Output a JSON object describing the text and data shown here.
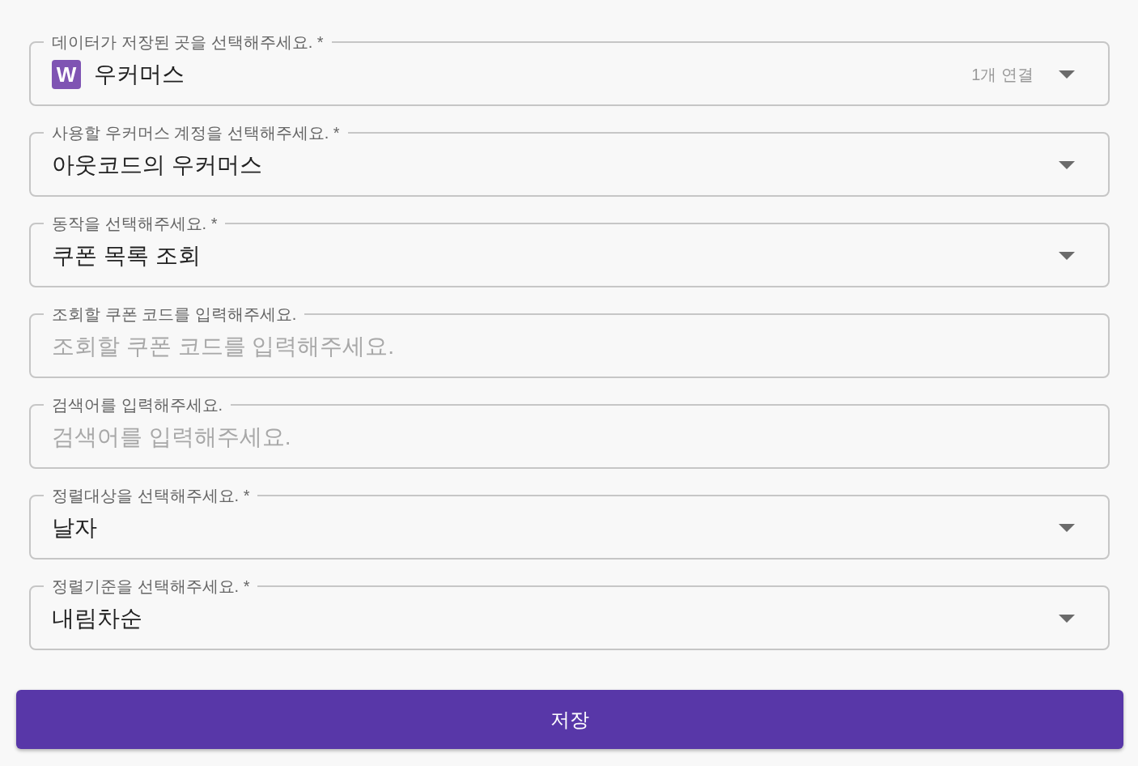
{
  "form": {
    "fields": [
      {
        "kind": "select",
        "label": "데이터가 저장된 곳을 선택해주세요. *",
        "logo": "W",
        "value": "우커머스",
        "hint": "1개 연결"
      },
      {
        "kind": "select",
        "label": "사용할 우커머스 계정을 선택해주세요. *",
        "value": "아웃코드의 우커머스"
      },
      {
        "kind": "select",
        "label": "동작을 선택해주세요. *",
        "value": "쿠폰 목록 조회"
      },
      {
        "kind": "text",
        "label": "조회할 쿠폰 코드를 입력해주세요.",
        "placeholder": "조회할 쿠폰 코드를 입력해주세요."
      },
      {
        "kind": "text",
        "label": "검색어를 입력해주세요.",
        "placeholder": "검색어를 입력해주세요."
      },
      {
        "kind": "select",
        "label": "정렬대상을 선택해주세요. *",
        "value": "날자"
      },
      {
        "kind": "select",
        "label": "정렬기준을 선택해주세요. *",
        "value": "내림차순"
      }
    ]
  },
  "save_button": {
    "label": "저장"
  }
}
